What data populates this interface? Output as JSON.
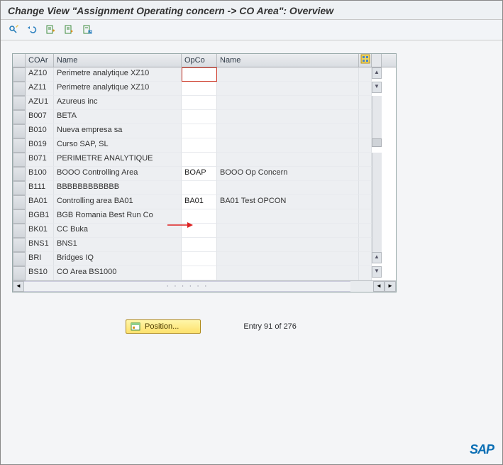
{
  "title": "Change View \"Assignment Operating concern -> CO Area\": Overview",
  "toolbar": {
    "icons": [
      "display-change-icon",
      "undo-icon",
      "new-entries-icon",
      "copy-icon",
      "delete-icon"
    ]
  },
  "columns": {
    "c1": "COAr",
    "c2": "Name",
    "c3": "OpCo",
    "c4": "Name"
  },
  "rows": [
    {
      "coar": "AZ10",
      "name": "Perimetre analytique XZ10",
      "opco": "",
      "oname": ""
    },
    {
      "coar": "AZ11",
      "name": "Perimetre analytique XZ10",
      "opco": "",
      "oname": ""
    },
    {
      "coar": "AZU1",
      "name": "Azureus inc",
      "opco": "",
      "oname": ""
    },
    {
      "coar": "B007",
      "name": "BETA",
      "opco": "",
      "oname": ""
    },
    {
      "coar": "B010",
      "name": "Nueva empresa sa",
      "opco": "",
      "oname": ""
    },
    {
      "coar": "B019",
      "name": "Curso SAP, SL",
      "opco": "",
      "oname": ""
    },
    {
      "coar": "B071",
      "name": "PERIMETRE ANALYTIQUE",
      "opco": "",
      "oname": ""
    },
    {
      "coar": "B100",
      "name": "BOOO  Controlling Area",
      "opco": "BOAP",
      "oname": "BOOO Op Concern"
    },
    {
      "coar": "B111",
      "name": "BBBBBBBBBBBB",
      "opco": "",
      "oname": ""
    },
    {
      "coar": "BA01",
      "name": "Controlling area BA01",
      "opco": "BA01",
      "oname": "BA01 Test OPCON"
    },
    {
      "coar": "BGB1",
      "name": "BGB Romania Best Run Co",
      "opco": "",
      "oname": ""
    },
    {
      "coar": "BK01",
      "name": "CC Buka",
      "opco": "",
      "oname": ""
    },
    {
      "coar": "BNS1",
      "name": "BNS1",
      "opco": "",
      "oname": ""
    },
    {
      "coar": "BRI",
      "name": "Bridges IQ",
      "opco": "",
      "oname": ""
    },
    {
      "coar": "BS10",
      "name": "CO Area BS1000",
      "opco": "",
      "oname": ""
    }
  ],
  "position_button": "Position...",
  "entry_text": "Entry 91 of 276",
  "logo": "SAP",
  "focus_row": 0,
  "highlight_row": 9
}
